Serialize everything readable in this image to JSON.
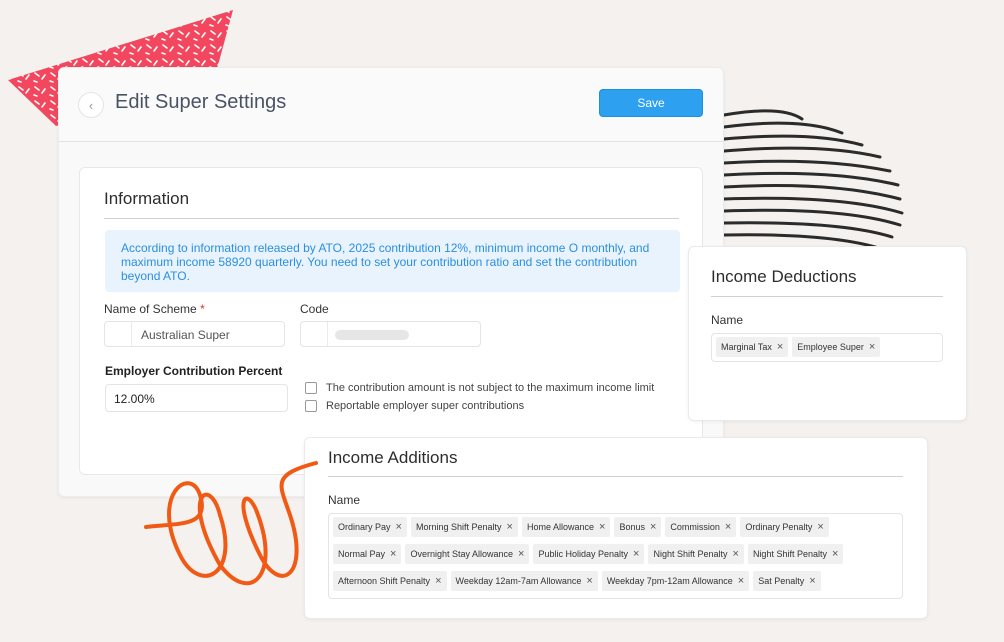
{
  "page": {
    "title": "Edit Super Settings",
    "save_label": "Save",
    "back_icon": "chevron-left-icon"
  },
  "information": {
    "title": "Information",
    "notice": "According to information released by ATO, 2025 contribution 12%, minimum income O monthly, and maximum income 58920 quarterly. You need to set your contribution ratio and set the contribution beyond ATO.",
    "scheme_label": "Name of Scheme",
    "required_mark": "*",
    "scheme_value": "Australian Super",
    "code_label": "Code",
    "code_value": "",
    "employer_label": "Employer Contribution Percent",
    "employer_value": "12.00%",
    "checkbox_1": "The contribution amount is not subject to the maximum income limit",
    "checkbox_2": "Reportable employer super contributions"
  },
  "deductions": {
    "title": "Income Deductions",
    "name_label": "Name",
    "tags": [
      "Marginal Tax",
      "Employee Super"
    ]
  },
  "additions": {
    "title": "Income Additions",
    "name_label": "Name",
    "tags": [
      [
        "Ordinary Pay",
        "Morning Shift Penalty",
        "Home Allowance",
        "Bonus",
        "Commission",
        "Ordinary Penalty"
      ],
      [
        "Normal Pay",
        "Overnight Stay Allowance",
        "Public Holiday Penalty",
        "Night Shift Penalty",
        "Night Shift Penalty"
      ],
      [
        "Afternoon Shift Penalty",
        "Weekday 12am-7am Allowance",
        "Weekday 7pm-12am Allowance",
        "Sat Penalty"
      ]
    ]
  },
  "colors": {
    "accent": "#2da0f0",
    "notice_bg": "#e8f3fd",
    "decor_red": "#f2475e",
    "decor_orange": "#f05a14"
  },
  "icons": {
    "tag_remove": "close-icon"
  }
}
